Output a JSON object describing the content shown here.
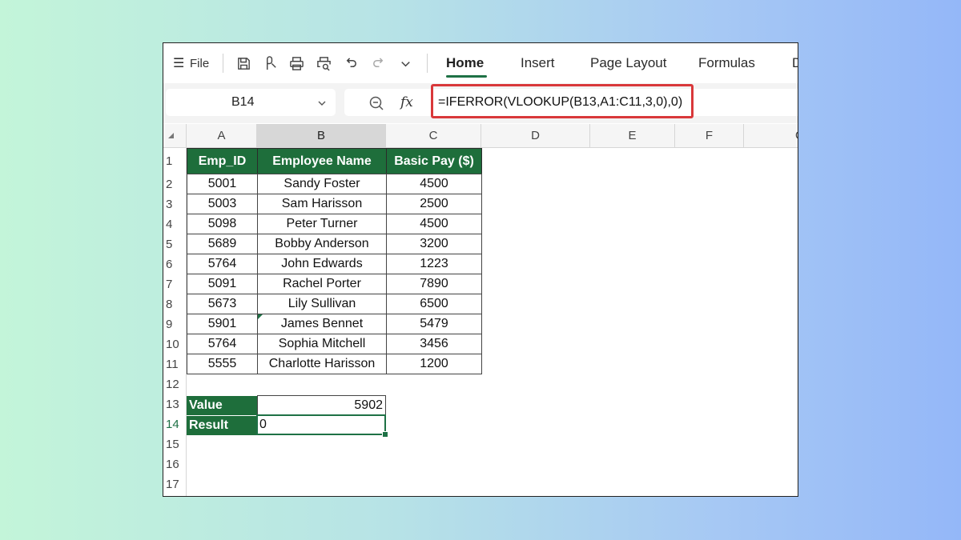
{
  "ribbon": {
    "menu_glyph": "☰",
    "file_label": "File",
    "tabs": [
      "Home",
      "Insert",
      "Page Layout",
      "Formulas",
      "D"
    ],
    "active_tab": "Home"
  },
  "formula_bar": {
    "name_box": "B14",
    "fx_label": "fx",
    "formula": "=IFERROR(VLOOKUP(B13,A1:C11,3,0),0)"
  },
  "columns": [
    "A",
    "B",
    "C",
    "D",
    "E",
    "F",
    "G"
  ],
  "selected_column": "B",
  "rows": [
    "1",
    "2",
    "3",
    "4",
    "5",
    "6",
    "7",
    "8",
    "9",
    "10",
    "11",
    "12",
    "13",
    "14",
    "15",
    "16",
    "17"
  ],
  "selected_row": "14",
  "table": {
    "headers": [
      "Emp_ID",
      "Employee Name",
      "Basic Pay ($)"
    ],
    "rows": [
      [
        "5001",
        "Sandy Foster",
        "4500"
      ],
      [
        "5003",
        "Sam Harisson",
        "2500"
      ],
      [
        "5098",
        "Peter Turner",
        "4500"
      ],
      [
        "5689",
        "Bobby Anderson",
        "3200"
      ],
      [
        "5764",
        "John Edwards",
        "1223"
      ],
      [
        "5091",
        "Rachel Porter",
        "7890"
      ],
      [
        "5673",
        "Lily Sullivan",
        "6500"
      ],
      [
        "5901",
        "James Bennet",
        "5479"
      ],
      [
        "5764",
        "Sophia Mitchell",
        "3456"
      ],
      [
        "5555",
        "Charlotte Harisson",
        "1200"
      ]
    ]
  },
  "lookup": {
    "value_label": "Value",
    "value": "5902",
    "result_label": "Result",
    "result": "0"
  },
  "colors": {
    "header_green": "#1e6e3b",
    "accent_green": "#1e7145",
    "highlight_red": "#d9383a"
  }
}
